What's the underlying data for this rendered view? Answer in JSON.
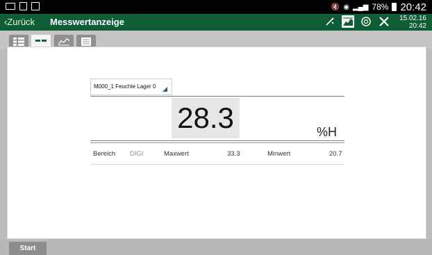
{
  "status_bar": {
    "wifi": "℞",
    "signal": ".❙",
    "battery": "78%",
    "time": "20:42"
  },
  "app_bar": {
    "back_label": "‹Zurück",
    "title": "Messwertanzeige",
    "date": "15.02.16",
    "time": "20:42"
  },
  "tabs": [
    {
      "icon": "list-icon",
      "active": false
    },
    {
      "icon": "single-value-icon",
      "active": true
    },
    {
      "icon": "chart-icon",
      "active": false
    },
    {
      "icon": "table-icon",
      "active": false
    }
  ],
  "measurement": {
    "channel_selected": "M000_1 Feuchte Lager 0",
    "value": "28.3",
    "unit": "%H",
    "range_label": "Bereich",
    "range_value": "DIGI",
    "max_label": "Maxwert",
    "max_value": "33.3",
    "min_label": "Minwert",
    "min_value": "20.7"
  },
  "bottom": {
    "start_label": "Start"
  },
  "colors": {
    "app_bar": "#0e5d36",
    "status_bar": "#000000",
    "active_tab": "#f5f5f5",
    "inactive_tab": "#8f8f8f",
    "start_button": "#8c8c8c"
  }
}
